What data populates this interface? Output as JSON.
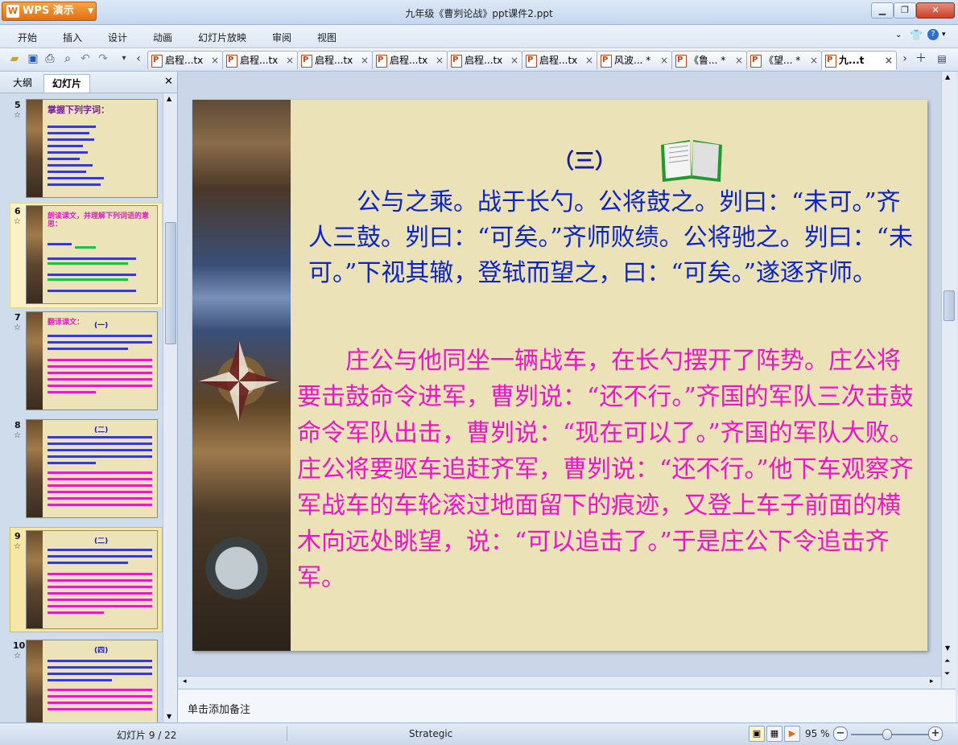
{
  "app": {
    "brand": "WPS 演示",
    "logo_glyph": "W",
    "document_title": "九年级《曹刿论战》ppt课件2.ppt"
  },
  "menu": [
    "开始",
    "插入",
    "设计",
    "动画",
    "幻灯片放映",
    "审阅",
    "视图"
  ],
  "tabs": [
    {
      "label": "启程...tx"
    },
    {
      "label": "启程...tx"
    },
    {
      "label": "启程...tx"
    },
    {
      "label": "启程...tx"
    },
    {
      "label": "启程...tx"
    },
    {
      "label": "启程...tx"
    },
    {
      "label": "风波... *"
    },
    {
      "label": "《鲁... *"
    },
    {
      "label": "《望... *"
    },
    {
      "label": "九...t",
      "active": true
    }
  ],
  "left_panel": {
    "tab_outline": "大纲",
    "tab_slides": "幻灯片",
    "thumbnails": [
      {
        "number": "5",
        "title": "掌握下列字词："
      },
      {
        "number": "6",
        "title": "朗读课文，并理解下列词语的意思："
      },
      {
        "number": "7",
        "title": "翻译课文：",
        "subtitle": "(一)"
      },
      {
        "number": "8",
        "subtitle": "(二)"
      },
      {
        "number": "9",
        "subtitle": "(二)",
        "selected": true
      },
      {
        "number": "10",
        "subtitle": "(四)"
      }
    ]
  },
  "slide": {
    "heading": "（三）",
    "classical_text": "　　公与之乘。战于长勺。公将鼓之。刿曰：“未可。”齐人三鼓。刿曰：“可矣。”齐师败绩。公将驰之。刿曰：“未可。”下视其辙，登轼而望之，曰：“可矣。”遂逐齐师。",
    "translation_text": "　　庄公与他同坐一辆战车，在长勺摆开了阵势。庄公将要击鼓命令进军，曹刿说：“还不行。”齐国的军队三次击鼓命令军队出击，曹刿说：“现在可以了。”齐国的军队大败。庄公将要驱车追赶齐军，曹刿说：“还不行。”他下车观察齐军战车的车轮滚过地面留下的痕迹，又登上车子前面的横木向远处眺望，说：“可以追击了。”于是庄公下令追击齐军。",
    "classical_color": "#0a24cc",
    "translation_color": "#ee14c8"
  },
  "notes": {
    "placeholder": "单击添加备注"
  },
  "status": {
    "slide_counter": "幻灯片 9 / 22",
    "theme": "Strategic",
    "zoom": "95 %",
    "zoom_value": 95
  }
}
